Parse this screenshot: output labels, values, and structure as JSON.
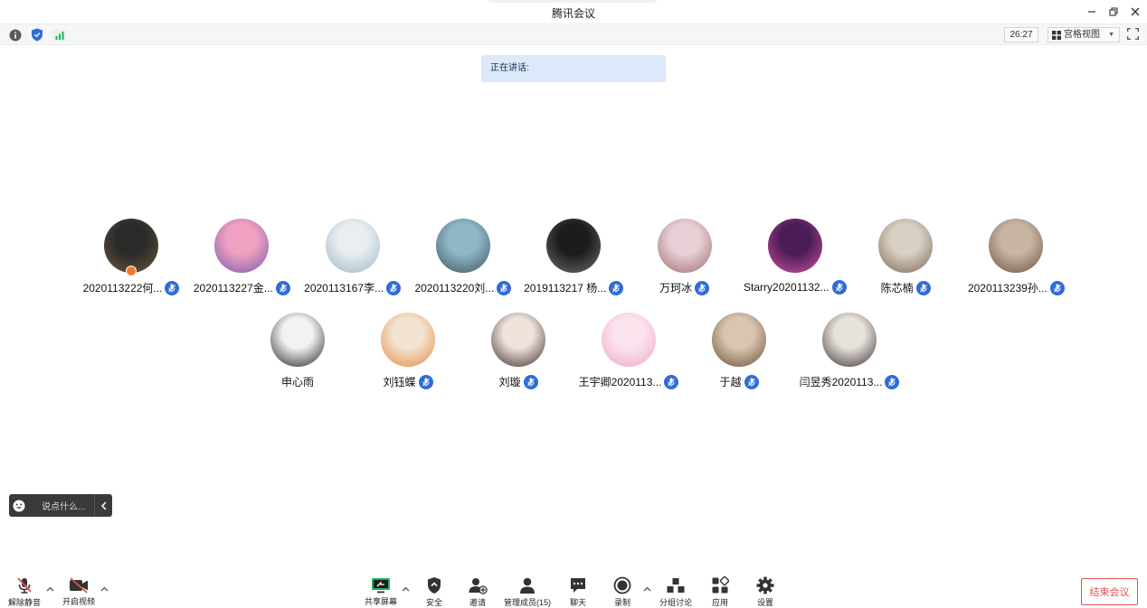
{
  "window": {
    "title": "腾讯会议"
  },
  "statusbar": {
    "timer": "26:27",
    "view_label": "宫格视图"
  },
  "speaking": {
    "label": "正在讲话:"
  },
  "participants": {
    "row1": [
      {
        "name": "2020113222何...",
        "colors": [
          "#2a2a2a",
          "#6b5a3a"
        ],
        "host": true
      },
      {
        "name": "2020113227金...",
        "colors": [
          "#f0a0c0",
          "#7a5ab0"
        ]
      },
      {
        "name": "2020113167李...",
        "colors": [
          "#e8eef2",
          "#9fb4c0"
        ]
      },
      {
        "name": "2020113220刘...",
        "colors": [
          "#8fb7c8",
          "#3e5560"
        ]
      },
      {
        "name": "2019113217 杨...",
        "colors": [
          "#1c1c1c",
          "#6d6d6d"
        ]
      },
      {
        "name": "万珂冰",
        "colors": [
          "#e8cfd6",
          "#9c6d6e"
        ]
      },
      {
        "name": "Starry20201132...",
        "colors": [
          "#4a1d58",
          "#d24fa0"
        ]
      },
      {
        "name": "陈芯楠",
        "colors": [
          "#d8d0c4",
          "#7c6652"
        ]
      },
      {
        "name": "2020113239孙...",
        "colors": [
          "#c9b5a3",
          "#6e5043"
        ]
      }
    ],
    "row2": [
      {
        "name": "申心雨",
        "colors": [
          "#f2f2f2",
          "#222222"
        ],
        "mic": false
      },
      {
        "name": "刘钰蝶",
        "colors": [
          "#f3e3d0",
          "#e58a45"
        ]
      },
      {
        "name": "刘璇",
        "colors": [
          "#efe3dc",
          "#3a2a28"
        ]
      },
      {
        "name": "王宇卿2020113...",
        "colors": [
          "#fbe3ee",
          "#f1a6c4"
        ]
      },
      {
        "name": "于越",
        "colors": [
          "#d9c6b0",
          "#6a4e3a"
        ]
      },
      {
        "name": "闫昱秀2020113...",
        "colors": [
          "#e8e2dc",
          "#3b302c"
        ]
      }
    ]
  },
  "chat": {
    "placeholder": "说点什么..."
  },
  "toolbar": {
    "unmute": "解除静音",
    "start_video": "开启视频",
    "share_screen": "共享屏幕",
    "security": "安全",
    "invite": "邀请",
    "manage_members": "管理成员(15)",
    "chat": "聊天",
    "record": "录制",
    "breakout": "分组讨论",
    "apps": "应用",
    "settings": "设置",
    "end_meeting": "结束会议"
  },
  "colors": {
    "accent": "#2f6bd9",
    "danger": "#e0524c",
    "banner": "#dce9fb",
    "share_green": "#1fb35a"
  }
}
